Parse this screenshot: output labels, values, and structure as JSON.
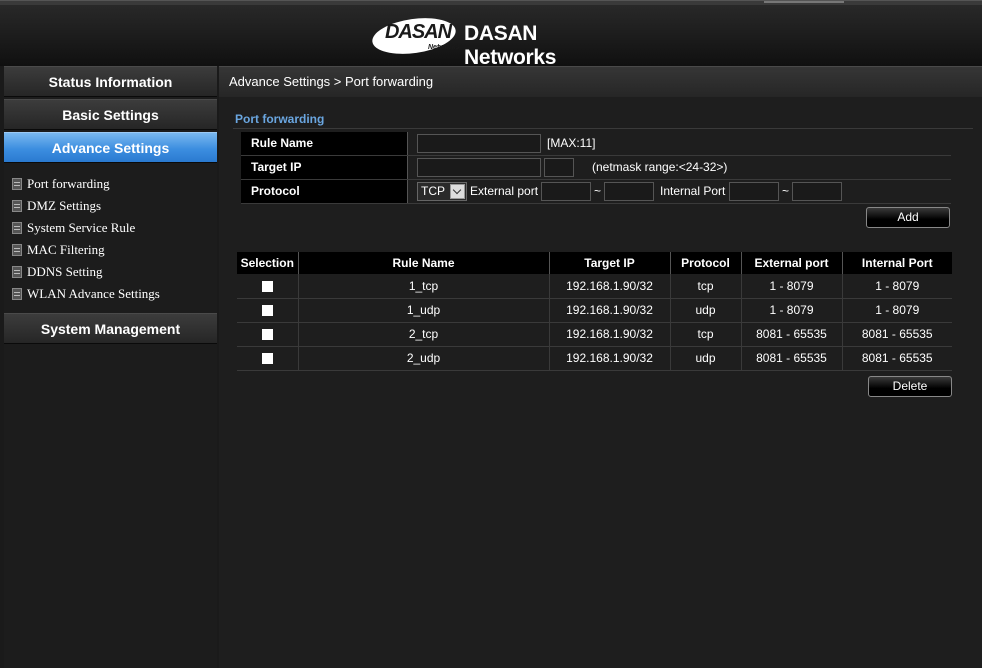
{
  "brand": {
    "logo_text": "DASAN",
    "logo_subtext": "Networks",
    "name": "DASAN Networks"
  },
  "sidebar": {
    "menus": [
      {
        "label": "Status Information",
        "active": false
      },
      {
        "label": "Basic Settings",
        "active": false
      },
      {
        "label": "Advance Settings",
        "active": true
      },
      {
        "label": "System Management",
        "active": false
      }
    ],
    "submenu": [
      {
        "label": "Port forwarding"
      },
      {
        "label": "DMZ Settings"
      },
      {
        "label": "System Service Rule"
      },
      {
        "label": "MAC Filtering"
      },
      {
        "label": "DDNS Setting"
      },
      {
        "label": "WLAN Advance Settings"
      }
    ]
  },
  "breadcrumb": "Advance Settings > Port forwarding",
  "form": {
    "section_title": "Port forwarding",
    "rule_name_label": "Rule Name",
    "rule_name_value": "",
    "rule_name_hint": "[MAX:11]",
    "target_ip_label": "Target IP",
    "target_ip_value": "",
    "netmask_value": "",
    "netmask_hint": "(netmask range:<24-32>)",
    "protocol_label": "Protocol",
    "protocol_selected": "TCP",
    "external_port_label": "External port",
    "internal_port_label": "Internal Port",
    "range_sep": "~",
    "add_label": "Add"
  },
  "table": {
    "headers": [
      "Selection",
      "Rule Name",
      "Target IP",
      "Protocol",
      "External port",
      "Internal Port"
    ],
    "rows": [
      {
        "name": "1_tcp",
        "ip": "192.168.1.90/32",
        "protocol": "tcp",
        "external": "1 - 8079",
        "internal": "1 - 8079"
      },
      {
        "name": "1_udp",
        "ip": "192.168.1.90/32",
        "protocol": "udp",
        "external": "1 - 8079",
        "internal": "1 - 8079"
      },
      {
        "name": "2_tcp",
        "ip": "192.168.1.90/32",
        "protocol": "tcp",
        "external": "8081 - 65535",
        "internal": "8081 - 65535"
      },
      {
        "name": "2_udp",
        "ip": "192.168.1.90/32",
        "protocol": "udp",
        "external": "8081 - 65535",
        "internal": "8081 - 65535"
      }
    ],
    "delete_label": "Delete"
  },
  "colors": {
    "accent": "#3c8ee0",
    "section_title": "#6aa6e0"
  }
}
